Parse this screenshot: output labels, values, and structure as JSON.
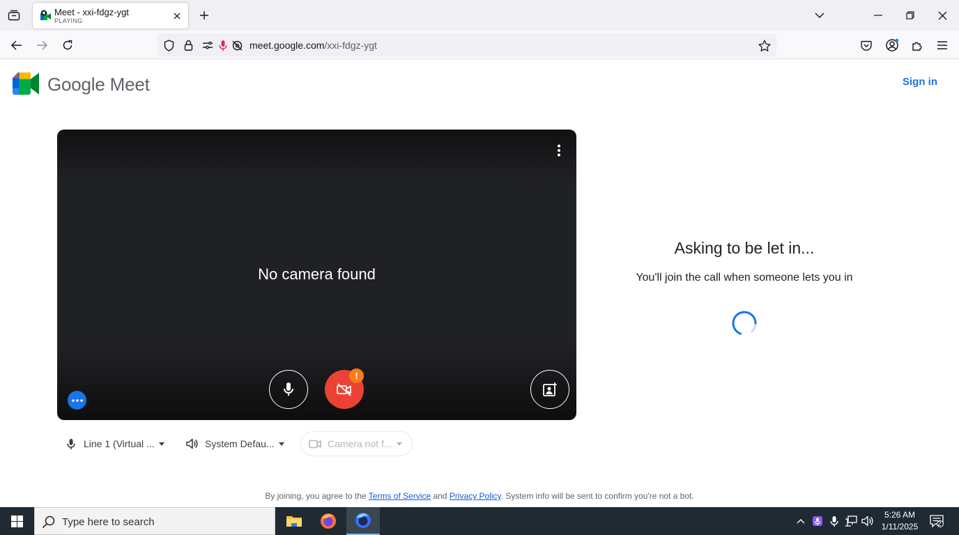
{
  "browser": {
    "tab": {
      "title": "Meet - xxi-fdgz-ygt",
      "subtitle": "PLAYING"
    },
    "url": {
      "host": "meet.google.com",
      "path": "/xxi-fdgz-ygt"
    }
  },
  "header": {
    "brand": "Google Meet",
    "signin_label": "Sign in"
  },
  "preview": {
    "message": "No camera found",
    "alert_badge": "!"
  },
  "devices": {
    "microphone": "Line 1 (Virtual ...",
    "speaker": "System Defau...",
    "camera": "Camera not f..."
  },
  "status": {
    "title": "Asking to be let in...",
    "subtitle": "You'll join the call when someone lets you in"
  },
  "legal": {
    "prefix": "By joining, you agree to the",
    "terms": "Terms of Service",
    "and": "and",
    "privacy": "Privacy Policy",
    "suffix": ". System info will be sent to confirm you're not a bot."
  },
  "taskbar": {
    "search_placeholder": "Type here to search",
    "time": "5:26 AM",
    "date": "1/11/2025",
    "notification_count": "2"
  },
  "colors": {
    "accent": "#1a73e8",
    "danger": "#ea4335",
    "warning": "#fa7b17",
    "preview_bg": "#202124"
  }
}
